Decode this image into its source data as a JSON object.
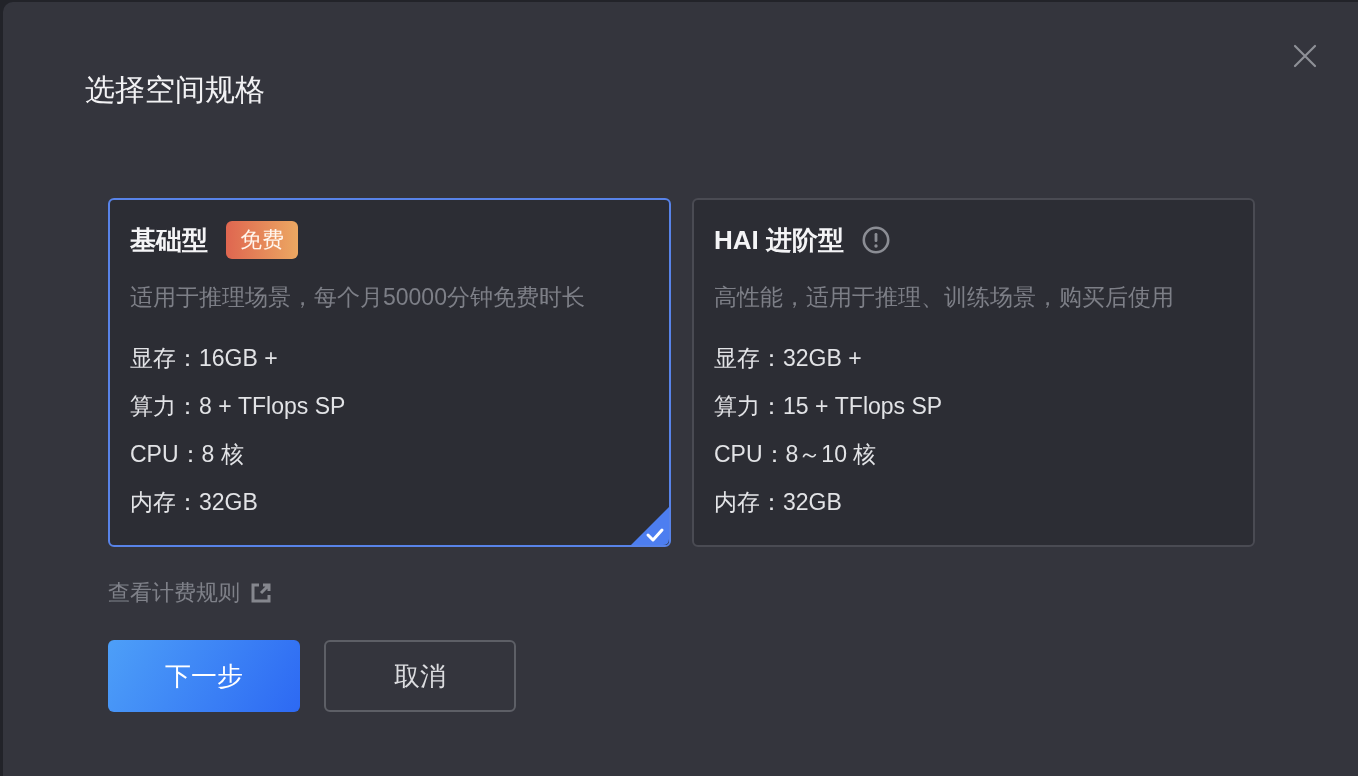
{
  "dialog": {
    "title": "选择空间规格"
  },
  "plans": [
    {
      "name": "基础型",
      "badge": "免费",
      "info_icon": false,
      "description": "适用于推理场景，每个月50000分钟免费时长",
      "specs": [
        "显存：16GB +",
        "算力：8 + TFlops SP",
        "CPU：8 核",
        "内存：32GB"
      ],
      "selected": true
    },
    {
      "name": "HAI 进阶型",
      "info_icon": true,
      "description": "高性能，适用于推理、训练场景，购买后使用",
      "specs": [
        "显存：32GB +",
        "算力：15 + TFlops SP",
        "CPU：8～10 核",
        "内存：32GB"
      ],
      "selected": false
    }
  ],
  "billing_link": "查看计费规则",
  "buttons": [
    {
      "label": "下一步",
      "kind": "primary"
    },
    {
      "label": "取消",
      "kind": "secondary"
    }
  ]
}
